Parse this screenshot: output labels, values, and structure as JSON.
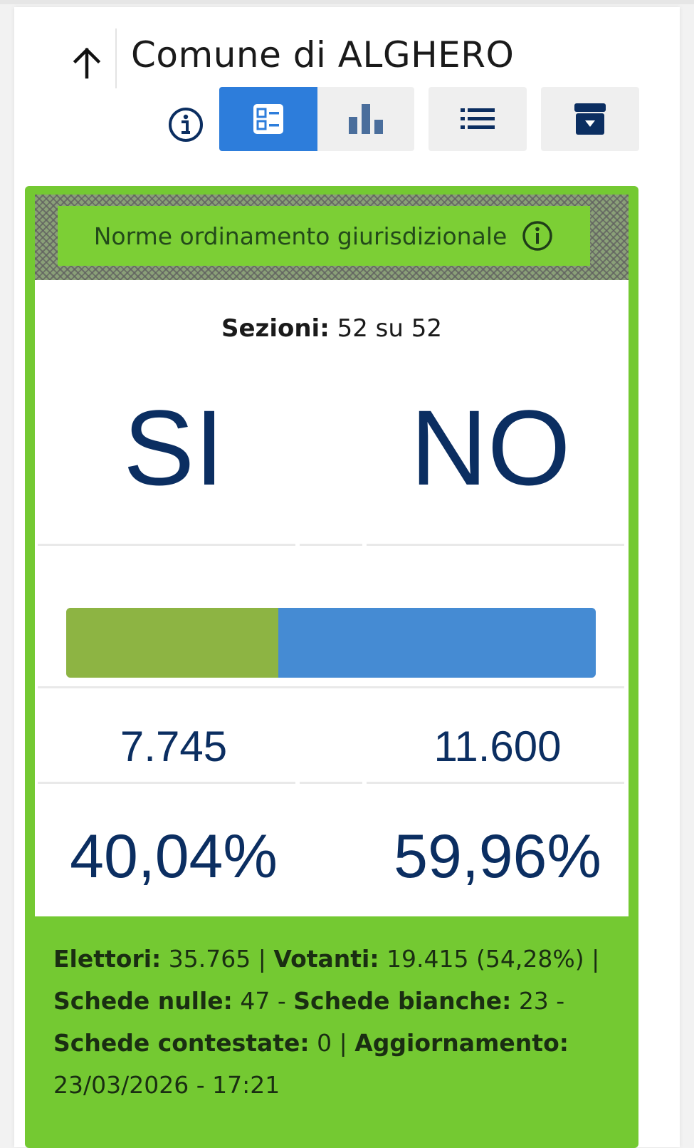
{
  "header": {
    "title": "Comune di ALGHERO",
    "back_icon": "arrow-up-icon",
    "info_icon": "info-circle-icon"
  },
  "toolbar": {
    "view_cards_icon": "cards-view-icon",
    "view_chart_icon": "bar-chart-icon",
    "view_list_icon": "list-icon",
    "archive_icon": "archive-download-icon",
    "active": "cards"
  },
  "referendum": {
    "title": "Norme ordinamento giurisdizionale",
    "sezioni_label": "Sezioni:",
    "sezioni_value": "52 su 52",
    "options": [
      {
        "label": "SI",
        "votes": "7.745",
        "percent": "40,04%",
        "share": 0.4004,
        "color": "#8db443"
      },
      {
        "label": "NO",
        "votes": "11.600",
        "percent": "59,96%",
        "share": 0.5996,
        "color": "#458bd3"
      }
    ]
  },
  "stats": {
    "elettori_label": "Elettori:",
    "elettori_value": "35.765",
    "votanti_label": "Votanti:",
    "votanti_value": "19.415 (54,28%)",
    "nulle_label": "Schede nulle:",
    "nulle_value": "47",
    "bianche_label": "Schede bianche:",
    "bianche_value": "23",
    "contestate_label": "Schede contestate:",
    "contestate_value": "0",
    "aggiornamento_label": "Aggiornamento:",
    "aggiornamento_value": "23/03/2026 - 17:21"
  },
  "colors": {
    "accent_blue": "#2d7ddb",
    "box_green": "#74c932",
    "text_navy": "#0b2e61"
  }
}
